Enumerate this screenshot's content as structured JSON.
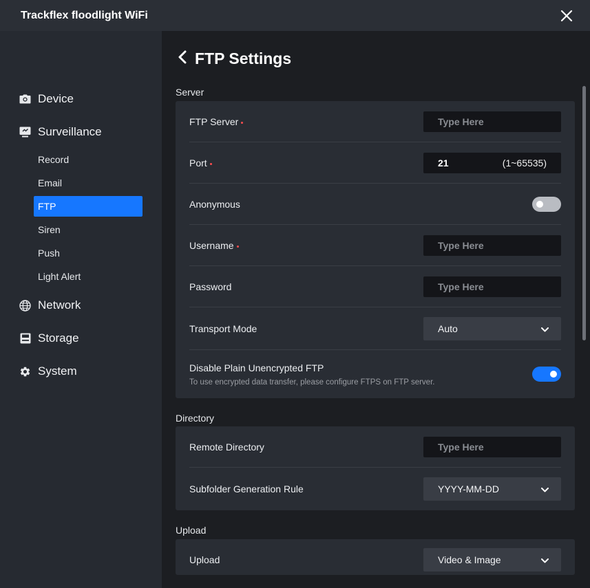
{
  "window": {
    "title": "Trackflex floodlight WiFi",
    "close_icon": "close-icon"
  },
  "sidebar": {
    "device": {
      "label": "Device",
      "icon": "camera-icon"
    },
    "surveillance": {
      "label": "Surveillance",
      "icon": "monitor-icon",
      "items": [
        {
          "label": "Record"
        },
        {
          "label": "Email"
        },
        {
          "label": "FTP",
          "active": true
        },
        {
          "label": "Siren"
        },
        {
          "label": "Push"
        },
        {
          "label": "Light Alert"
        }
      ]
    },
    "network": {
      "label": "Network",
      "icon": "globe-icon"
    },
    "storage": {
      "label": "Storage",
      "icon": "storage-icon"
    },
    "system": {
      "label": "System",
      "icon": "gear-icon"
    }
  },
  "page": {
    "back_icon": "chevron-left-icon",
    "title": "FTP Settings"
  },
  "server": {
    "label": "Server",
    "ftp_server": {
      "label": "FTP Server",
      "placeholder": "Type Here",
      "value": ""
    },
    "port": {
      "label": "Port",
      "value": "21",
      "range": "(1~65535)"
    },
    "anonymous": {
      "label": "Anonymous",
      "enabled": false
    },
    "username": {
      "label": "Username",
      "placeholder": "Type Here",
      "value": ""
    },
    "password": {
      "label": "Password",
      "placeholder": "Type Here",
      "value": ""
    },
    "transport_mode": {
      "label": "Transport Mode",
      "value": "Auto"
    },
    "disable_plain": {
      "label": "Disable Plain Unencrypted FTP",
      "hint": "To use encrypted data transfer, please configure FTPS on FTP server.",
      "enabled": true
    }
  },
  "directory": {
    "label": "Directory",
    "remote_directory": {
      "label": "Remote Directory",
      "placeholder": "Type Here",
      "value": ""
    },
    "subfolder_rule": {
      "label": "Subfolder Generation Rule",
      "value": "YYYY-MM-DD"
    }
  },
  "upload": {
    "label": "Upload",
    "upload": {
      "label": "Upload",
      "value": "Video & Image"
    }
  },
  "colors": {
    "accent": "#1677ff",
    "required": "#ff4d4f"
  }
}
